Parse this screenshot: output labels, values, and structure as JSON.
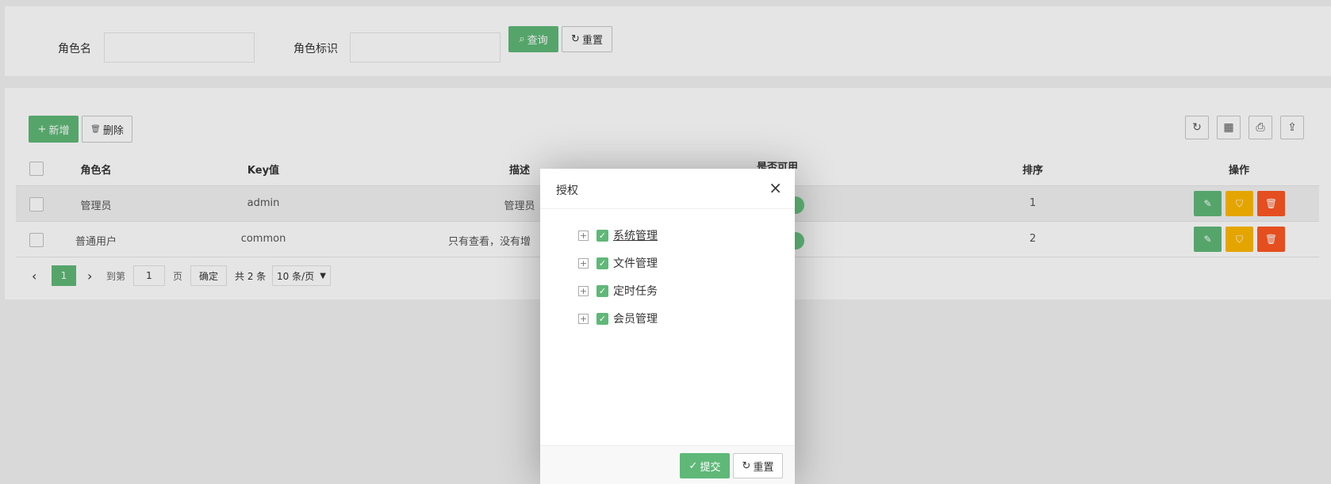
{
  "search": {
    "role_name_label": "角色名",
    "role_key_label": "角色标识",
    "query_label": "查询",
    "reset_label": "重置"
  },
  "toolbar": {
    "add_label": "新增",
    "delete_label": "删除",
    "icons": [
      "refresh-icon",
      "columns-icon",
      "print-icon",
      "export-icon"
    ]
  },
  "table": {
    "headers": [
      "角色名",
      "Key值",
      "描述",
      "是否可用",
      "排序",
      "操作"
    ],
    "rows": [
      {
        "name": "管理员",
        "key": "admin",
        "desc": "管理员",
        "sort": "1"
      },
      {
        "name": "普通用户",
        "key": "common",
        "desc": "只有查看，没有增",
        "sort": "2"
      }
    ]
  },
  "pager": {
    "current_page": "1",
    "goto_label": "到第",
    "goto_value": "1",
    "page_unit": "页",
    "confirm_label": "确定",
    "total_label": "共 2 条",
    "page_size": "10 条/页"
  },
  "modal": {
    "title": "授权",
    "tree": [
      {
        "label": "系统管理",
        "checked": true
      },
      {
        "label": "文件管理",
        "checked": true
      },
      {
        "label": "定时任务",
        "checked": true
      },
      {
        "label": "会员管理",
        "checked": true
      }
    ],
    "submit_label": "提交",
    "reset_label": "重置"
  },
  "colors": {
    "primary": "#5fb878",
    "warn": "#ffb800",
    "danger": "#ff5722"
  }
}
